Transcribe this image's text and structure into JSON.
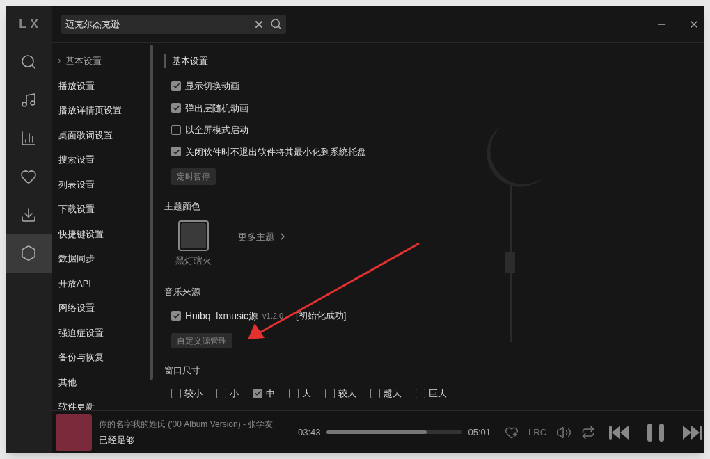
{
  "logo": "LX",
  "nav": [
    {
      "kind": "search",
      "selected": false
    },
    {
      "kind": "music",
      "selected": false
    },
    {
      "kind": "chart",
      "selected": false
    },
    {
      "kind": "heart",
      "selected": false
    },
    {
      "kind": "download",
      "selected": false
    },
    {
      "kind": "settings",
      "selected": true
    }
  ],
  "search": {
    "value": "迈克尔杰克逊"
  },
  "settings_menu": [
    {
      "label": "基本设置",
      "selected": true
    },
    {
      "label": "播放设置",
      "selected": false
    },
    {
      "label": "播放详情页设置",
      "selected": false
    },
    {
      "label": "桌面歌词设置",
      "selected": false
    },
    {
      "label": "搜索设置",
      "selected": false
    },
    {
      "label": "列表设置",
      "selected": false
    },
    {
      "label": "下载设置",
      "selected": false
    },
    {
      "label": "快捷键设置",
      "selected": false
    },
    {
      "label": "数据同步",
      "selected": false
    },
    {
      "label": "开放API",
      "selected": false
    },
    {
      "label": "网络设置",
      "selected": false
    },
    {
      "label": "强迫症设置",
      "selected": false
    },
    {
      "label": "备份与恢复",
      "selected": false
    },
    {
      "label": "其他",
      "selected": false
    },
    {
      "label": "软件更新",
      "selected": false
    }
  ],
  "basic": {
    "title": "基本设置",
    "options": [
      {
        "label": "显示切换动画",
        "checked": true
      },
      {
        "label": "弹出层随机动画",
        "checked": true
      },
      {
        "label": "以全屏模式启动",
        "checked": false
      },
      {
        "label": "关闭软件时不退出软件将其最小化到系统托盘",
        "checked": true
      }
    ],
    "button": "定时暂停"
  },
  "theme": {
    "title": "主题颜色",
    "themes": [
      {
        "name": "黑灯瞎火",
        "selected": true
      }
    ],
    "more": "更多主题"
  },
  "source": {
    "title": "音乐来源",
    "sources": [
      {
        "name": "Huibq_lxmusic源",
        "version": "v1.2.0",
        "status": "[初始化成功]",
        "checked": true
      }
    ],
    "button": "自定义源管理"
  },
  "window_size": {
    "title": "窗口尺寸",
    "options": [
      {
        "label": "较小",
        "checked": false
      },
      {
        "label": "小",
        "checked": false
      },
      {
        "label": "中",
        "checked": true
      },
      {
        "label": "大",
        "checked": false
      },
      {
        "label": "较大",
        "checked": false
      },
      {
        "label": "超大",
        "checked": false
      },
      {
        "label": "巨大",
        "checked": false
      }
    ]
  },
  "player": {
    "title": "你的名字我的姓氏 ('00 Album Version) - 张学友",
    "lyric": "已经足够",
    "elapsed": "03:43",
    "total": "05:01",
    "level": 0.74,
    "lrc": "LRC"
  }
}
